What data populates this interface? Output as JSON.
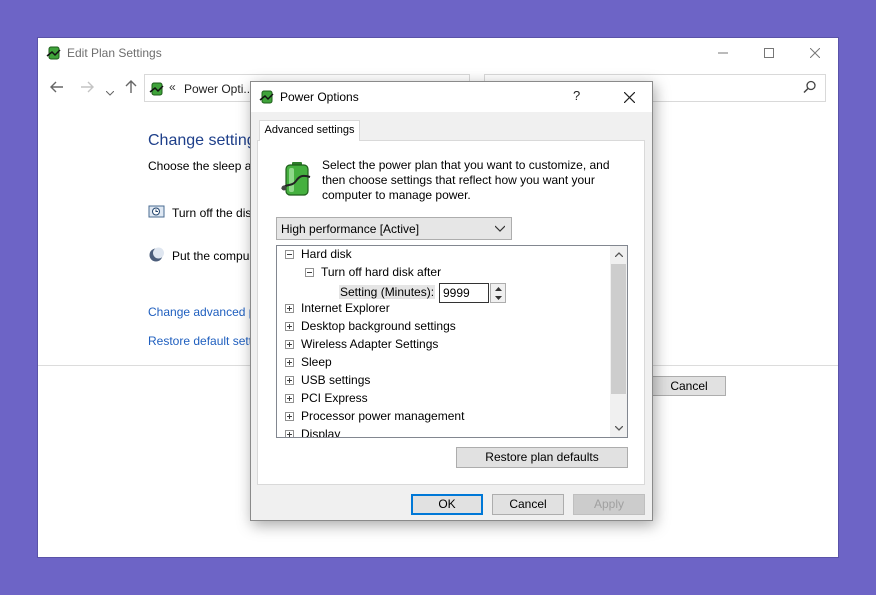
{
  "background_window": {
    "title": "Edit Plan Settings",
    "address_breadcrumb": "Power Opti...",
    "address_chevron": "«",
    "heading": "Change setting",
    "subheading": "Choose the sleep ar",
    "rows": [
      "Turn off the dis",
      "Put the compu"
    ],
    "links": [
      "Change advanced p",
      "Restore default setti"
    ],
    "cancel_label": "Cancel"
  },
  "dialog": {
    "title": "Power Options",
    "help_label": "?",
    "tab_label": "Advanced settings",
    "description_lines": [
      "Select the power plan that you want to customize, and",
      "then choose settings that reflect how you want your",
      "computer to manage power."
    ],
    "plan_selected": "High performance [Active]",
    "tree": {
      "hard_disk": "Hard disk",
      "turn_off_after": "Turn off hard disk after",
      "setting_label": "Setting (Minutes):",
      "setting_value": "9999",
      "items": [
        "Internet Explorer",
        "Desktop background settings",
        "Wireless Adapter Settings",
        "Sleep",
        "USB settings",
        "PCI Express",
        "Processor power management",
        "Display"
      ]
    },
    "restore_label": "Restore plan defaults",
    "ok_label": "OK",
    "cancel_label": "Cancel",
    "apply_label": "Apply"
  },
  "colors": {
    "desktop": "#6d64c6",
    "link": "#1f5fbf",
    "heading": "#1e3f8a",
    "default_button_border": "#0078d7"
  }
}
